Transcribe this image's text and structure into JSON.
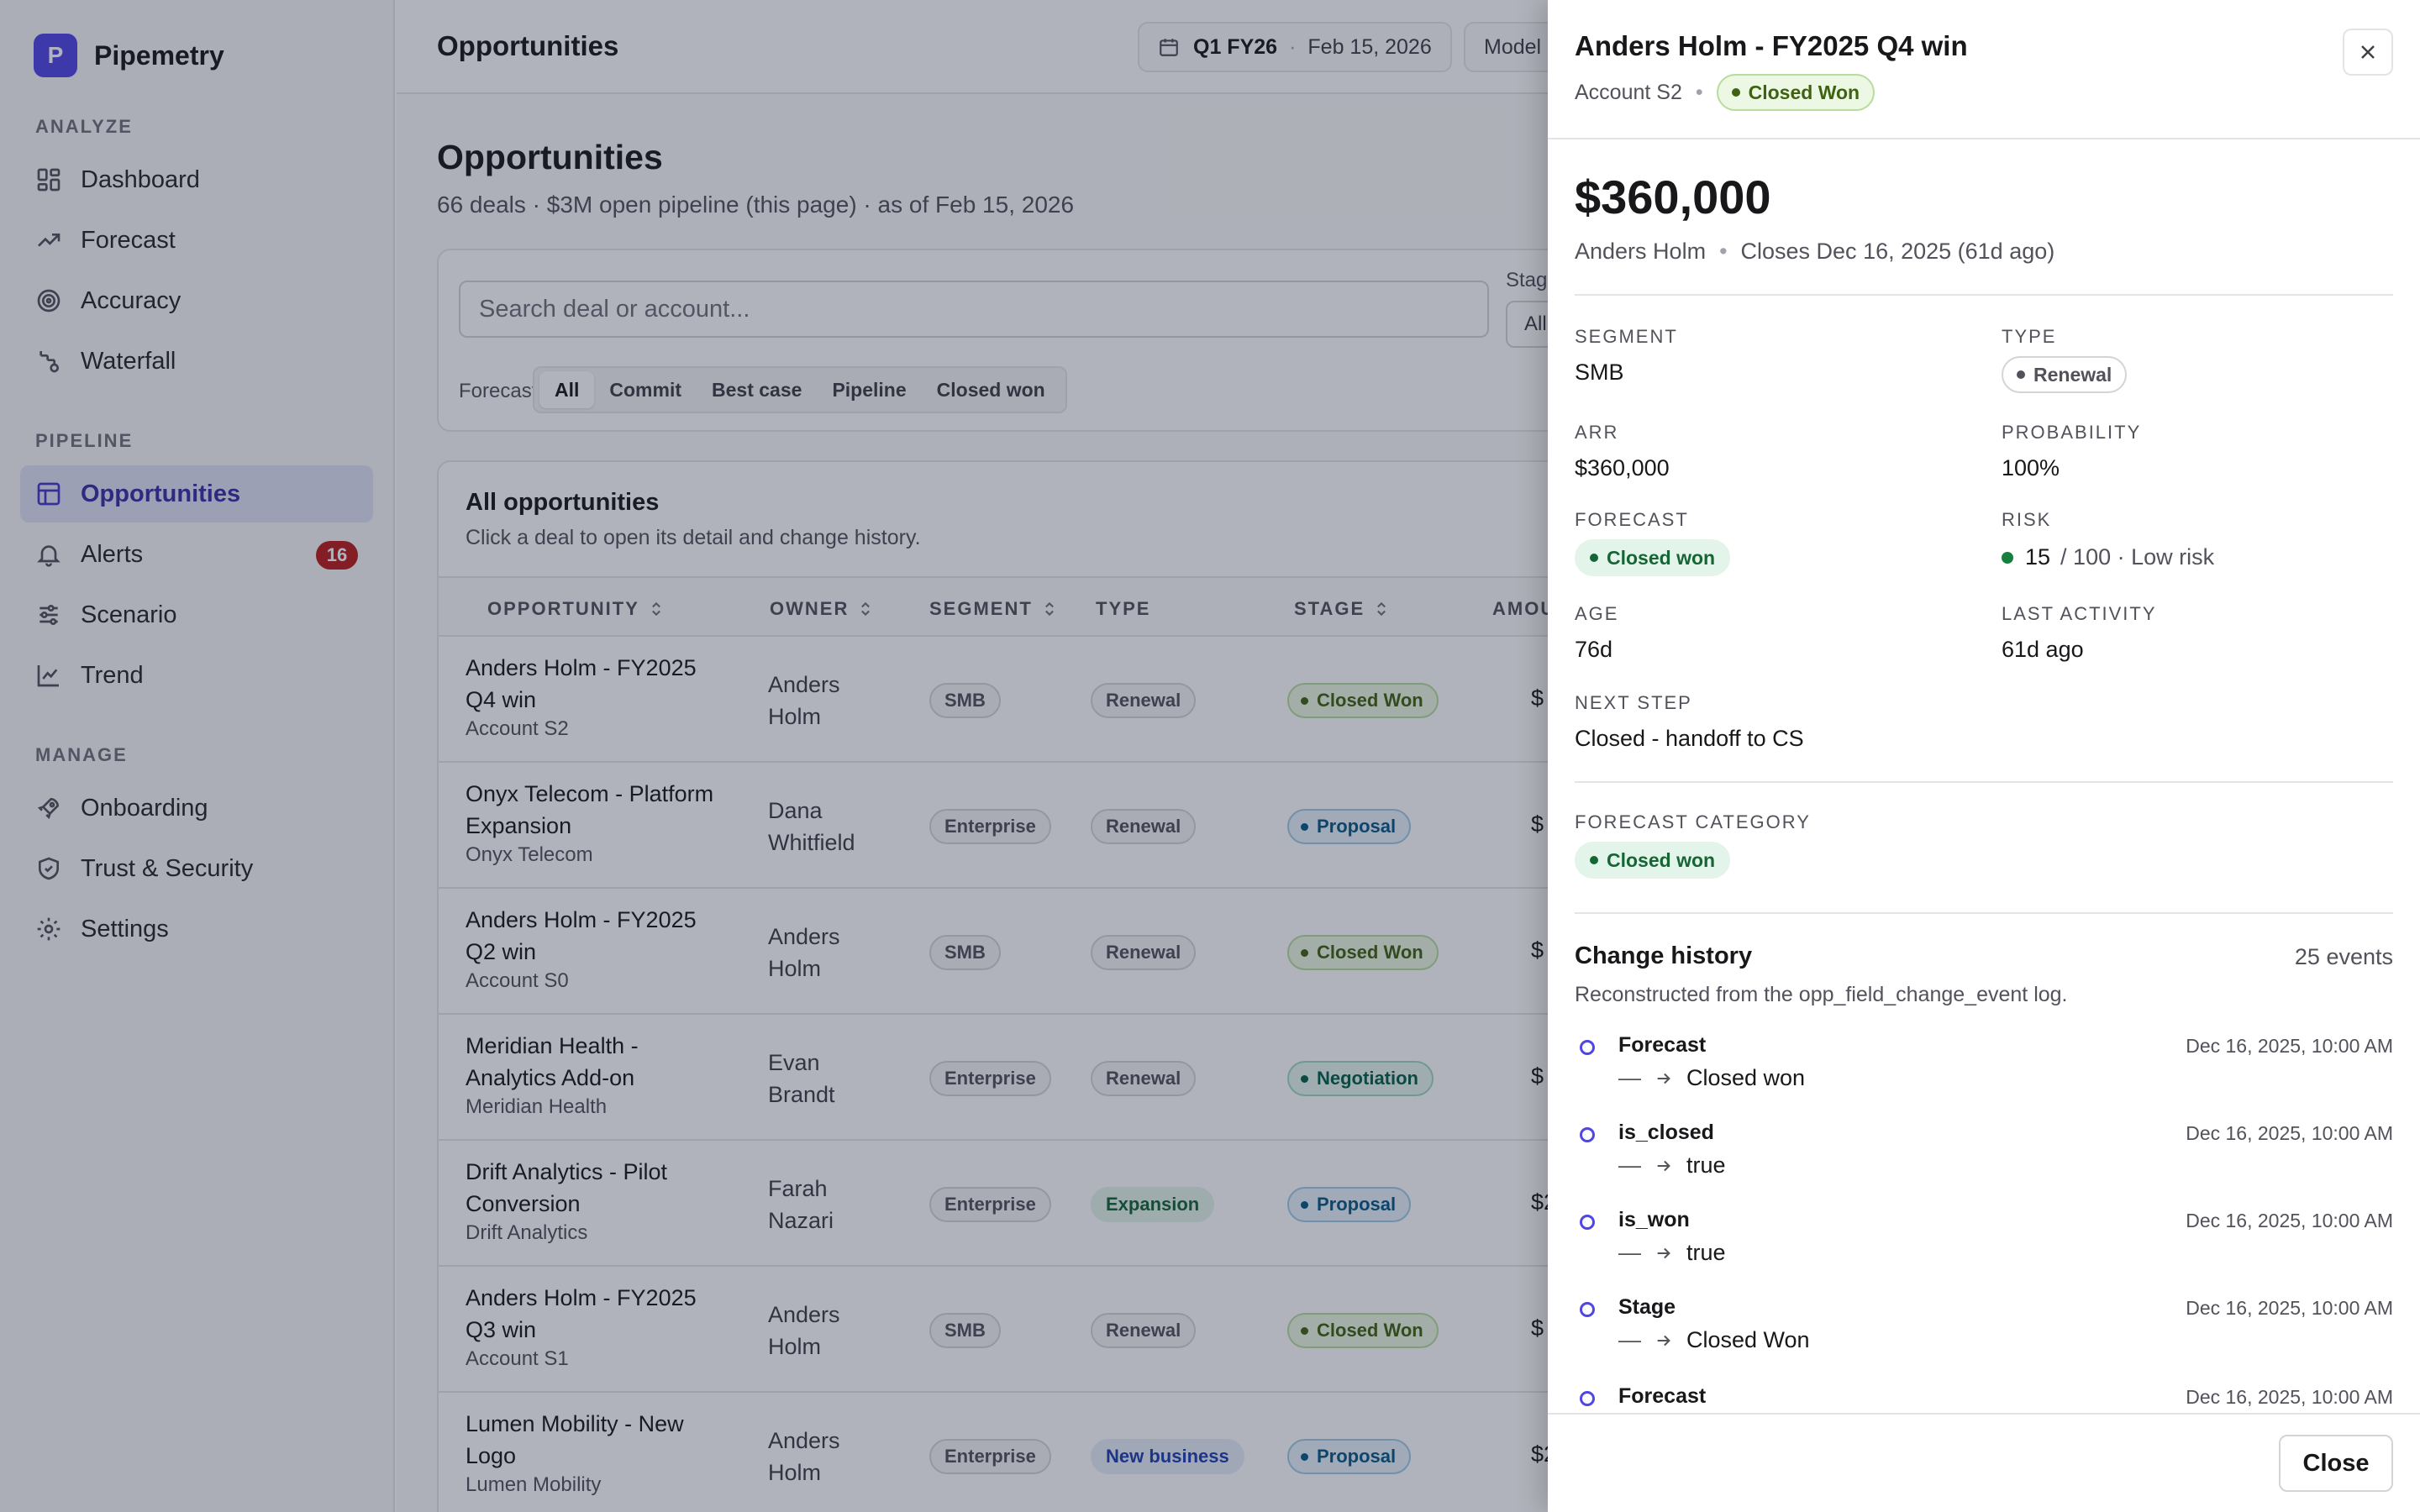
{
  "app": {
    "brand_initial": "P",
    "brand_name": "Pipemetry"
  },
  "sidebar": {
    "sections": [
      {
        "title": "ANALYZE"
      },
      {
        "title": "PIPELINE"
      },
      {
        "title": "MANAGE"
      }
    ],
    "items": [
      {
        "label": "Dashboard",
        "icon": "dashboard-icon"
      },
      {
        "label": "Forecast",
        "icon": "trending-up-icon"
      },
      {
        "label": "Accuracy",
        "icon": "target-icon"
      },
      {
        "label": "Waterfall",
        "icon": "waterfall-icon"
      },
      {
        "label": "Opportunities",
        "icon": "table-icon",
        "active": true
      },
      {
        "label": "Alerts",
        "icon": "bell-icon",
        "badge": "16"
      },
      {
        "label": "Scenario",
        "icon": "sliders-icon"
      },
      {
        "label": "Trend",
        "icon": "line-chart-icon"
      },
      {
        "label": "Onboarding",
        "icon": "rocket-icon"
      },
      {
        "label": "Trust & Security",
        "icon": "shield-icon"
      },
      {
        "label": "Settings",
        "icon": "gear-icon"
      }
    ]
  },
  "topbar": {
    "title": "Opportunities",
    "period_bold": "Q1 FY26",
    "period_sep": "·",
    "period_date": "Feb 15, 2026",
    "model_label": "Model"
  },
  "page": {
    "title": "Opportunities",
    "subtitle": "66 deals · $3M open pipeline (this page) · as of Feb 15, 2026"
  },
  "filters": {
    "search_placeholder": "Search deal or account...",
    "stage_label": "Stag",
    "stage_value": "All",
    "forecast_label": "Forecast",
    "forecast_options": [
      "All",
      "Commit",
      "Best case",
      "Pipeline",
      "Closed won"
    ],
    "forecast_selected": "All"
  },
  "table": {
    "title": "All opportunities",
    "subtitle": "Click a deal to open its detail and change history.",
    "columns": [
      "OPPORTUNITY",
      "OWNER",
      "SEGMENT",
      "TYPE",
      "STAGE",
      "AMOU"
    ],
    "rows": [
      {
        "name": "Anders Holm - FY2025 Q4 win",
        "account": "Account S2",
        "owner": "Anders Holm",
        "segment": "SMB",
        "type": "Renewal",
        "stage": "Closed Won",
        "amount": "$"
      },
      {
        "name": "Onyx Telecom - Platform Expansion",
        "account": "Onyx Telecom",
        "owner": "Dana Whitfield",
        "segment": "Enterprise",
        "type": "Renewal",
        "stage": "Proposal",
        "amount": "$"
      },
      {
        "name": "Anders Holm - FY2025 Q2 win",
        "account": "Account S0",
        "owner": "Anders Holm",
        "segment": "SMB",
        "type": "Renewal",
        "stage": "Closed Won",
        "amount": "$"
      },
      {
        "name": "Meridian Health - Analytics Add-on",
        "account": "Meridian Health",
        "owner": "Evan Brandt",
        "segment": "Enterprise",
        "type": "Renewal",
        "stage": "Negotiation",
        "amount": "$"
      },
      {
        "name": "Drift Analytics - Pilot Conversion",
        "account": "Drift Analytics",
        "owner": "Farah Nazari",
        "segment": "Enterprise",
        "type": "Expansion",
        "stage": "Proposal",
        "amount": "$2"
      },
      {
        "name": "Anders Holm - FY2025 Q3 win",
        "account": "Account S1",
        "owner": "Anders Holm",
        "segment": "SMB",
        "type": "Renewal",
        "stage": "Closed Won",
        "amount": "$"
      },
      {
        "name": "Lumen Mobility - New Logo",
        "account": "Lumen Mobility",
        "owner": "Anders Holm",
        "segment": "Enterprise",
        "type": "New business",
        "stage": "Proposal",
        "amount": "$2"
      }
    ]
  },
  "drawer": {
    "title": "Anders Holm - FY2025 Q4 win",
    "account": "Account S2",
    "sep": "•",
    "stage_badge": "Closed Won",
    "amount": "$360,000",
    "owner": "Anders Holm",
    "closes": "Closes Dec 16, 2025 (61d ago)",
    "fields": {
      "segment_label": "SEGMENT",
      "segment": "SMB",
      "type_label": "TYPE",
      "type": "Renewal",
      "arr_label": "ARR",
      "arr": "$360,000",
      "probability_label": "PROBABILITY",
      "probability": "100%",
      "forecast_label": "FORECAST",
      "forecast": "Closed won",
      "risk_label": "RISK",
      "risk_score": "15",
      "risk_detail": "/ 100 · Low risk",
      "age_label": "AGE",
      "age": "76d",
      "last_activity_label": "LAST ACTIVITY",
      "last_activity": "61d ago",
      "next_step_label": "NEXT STEP",
      "next_step": "Closed - handoff to CS",
      "forecast_category_label": "FORECAST CATEGORY",
      "forecast_category": "Closed won"
    },
    "history": {
      "title": "Change history",
      "count": "25 events",
      "subtitle": "Reconstructed from the opp_field_change_event log.",
      "events": [
        {
          "field": "Forecast",
          "from": "—",
          "to": "Closed won",
          "time": "Dec 16, 2025, 10:00 AM"
        },
        {
          "field": "is_closed",
          "from": "—",
          "to": "true",
          "time": "Dec 16, 2025, 10:00 AM"
        },
        {
          "field": "is_won",
          "from": "—",
          "to": "true",
          "time": "Dec 16, 2025, 10:00 AM"
        },
        {
          "field": "Stage",
          "from": "—",
          "to": "Closed Won",
          "time": "Dec 16, 2025, 10:00 AM"
        },
        {
          "field": "Forecast",
          "from": "",
          "to": "",
          "time": "Dec 16, 2025, 10:00 AM"
        }
      ]
    },
    "close_label": "Close"
  },
  "colors": {
    "accent": "#4f46e5",
    "alert_badge": "#b91c1c",
    "closed_won": "#3f6212",
    "proposal": "#075985",
    "negotiation": "#065f46",
    "low_risk": "#15803d"
  }
}
